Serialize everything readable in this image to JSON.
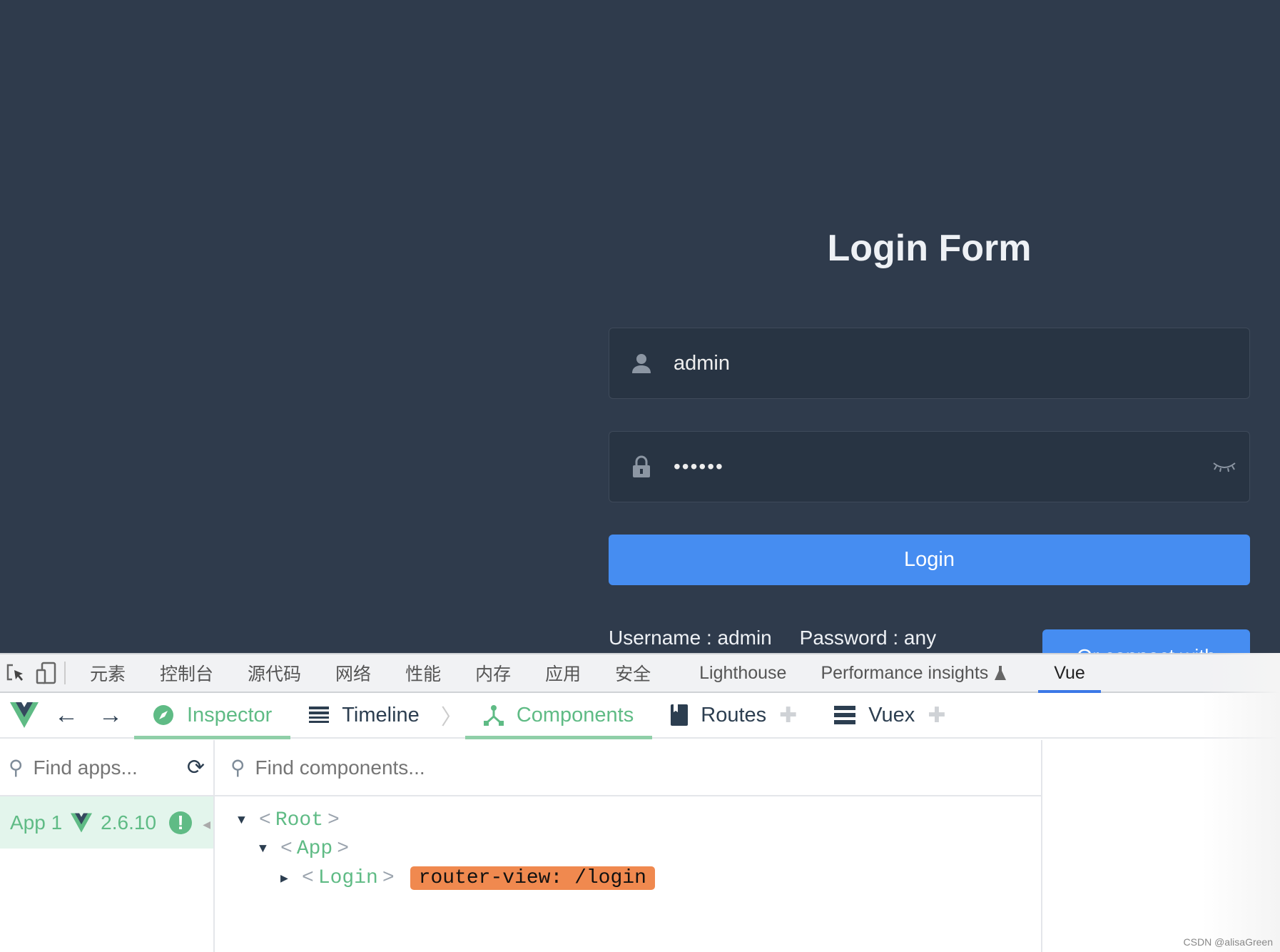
{
  "login": {
    "title": "Login Form",
    "username_value": "admin",
    "password_value": "••••••",
    "login_label": "Login",
    "tips": "Username : admin     Password : any",
    "third_party_label": "Or connect with"
  },
  "devtools": {
    "tabs": [
      "元素",
      "控制台",
      "源代码",
      "网络",
      "性能",
      "内存",
      "应用",
      "安全",
      "Lighthouse",
      "Performance insights",
      "Vue"
    ],
    "active_tab": "Vue",
    "vue": {
      "tabs": {
        "inspector": "Inspector",
        "timeline": "Timeline",
        "components": "Components",
        "routes": "Routes",
        "vuex": "Vuex"
      },
      "find_apps_placeholder": "Find apps...",
      "find_components_placeholder": "Find components...",
      "app": {
        "name": "App 1",
        "version": "2.6.10"
      },
      "tree": [
        {
          "name": "Root",
          "expanded": true
        },
        {
          "name": "App",
          "expanded": true
        },
        {
          "name": "Login",
          "expanded": false,
          "badge": "router-view: /login"
        }
      ],
      "accent": "#42b883"
    }
  },
  "watermark": "CSDN @alisaGreen"
}
